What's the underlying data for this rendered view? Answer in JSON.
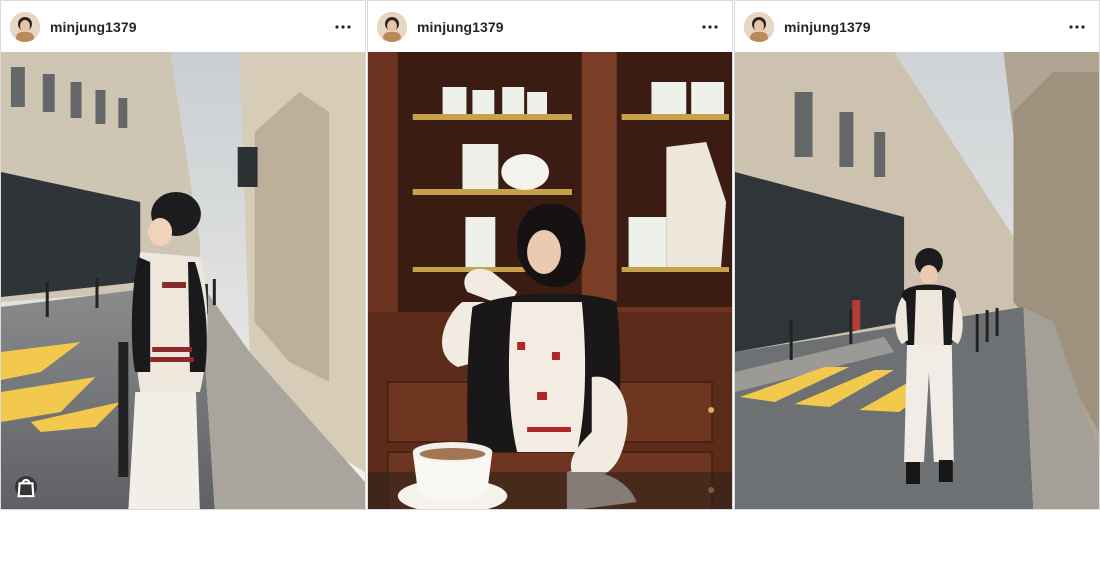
{
  "posts": [
    {
      "username": "minjung1379",
      "more_icon": "more-horizontal-icon",
      "has_shop_badge": true,
      "shop_icon": "shopping-bag-icon"
    },
    {
      "username": "minjung1379",
      "more_icon": "more-horizontal-icon",
      "has_shop_badge": false
    },
    {
      "username": "minjung1379",
      "more_icon": "more-horizontal-icon",
      "has_shop_badge": false
    }
  ],
  "colors": {
    "border": "#dbdbdb",
    "text": "#262626",
    "crosswalk_yellow": "#f2c94c"
  }
}
